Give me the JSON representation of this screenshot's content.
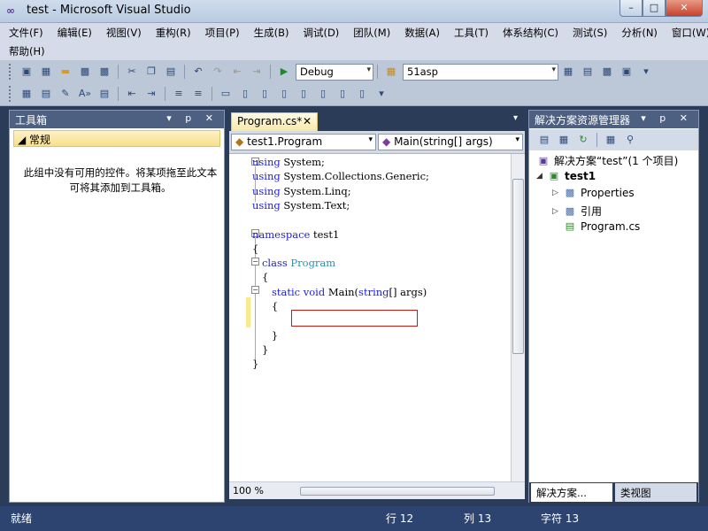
{
  "window": {
    "title": "test - Microsoft Visual Studio",
    "min": "–",
    "max": "□",
    "close": "✕"
  },
  "menu": {
    "row1": [
      "文件(F)",
      "编辑(E)",
      "视图(V)",
      "重构(R)",
      "项目(P)",
      "生成(B)",
      "调试(D)",
      "团队(M)",
      "数据(A)",
      "工具(T)",
      "体系结构(C)",
      "测试(S)",
      "分析(N)",
      "窗口(W)"
    ],
    "row2": [
      "帮助(H)"
    ]
  },
  "toolbar": {
    "config": "Debug",
    "find": "51asp",
    "combo_arrow": "▾"
  },
  "toolbox": {
    "title": "工具箱",
    "controls": "▾ p ✕",
    "group": "◢ 常规",
    "empty_message": "此组中没有可用的控件。将某项拖至此文本可将其添加到工具箱。"
  },
  "editor": {
    "tab_label": "Program.cs*",
    "tab_close": "✕",
    "class_combo": "test1.Program",
    "member_combo": "Main(string[] args)",
    "zoom": "100 %",
    "lines": [
      {
        "n": 0,
        "parts": [
          [
            "kw",
            "using"
          ],
          [
            "",
            " System;"
          ]
        ]
      },
      {
        "n": 1,
        "parts": [
          [
            "kw",
            "using"
          ],
          [
            "",
            " System.Collections.Generic;"
          ]
        ]
      },
      {
        "n": 2,
        "parts": [
          [
            "kw",
            "using"
          ],
          [
            "",
            " System.Linq;"
          ]
        ]
      },
      {
        "n": 3,
        "parts": [
          [
            "kw",
            "using"
          ],
          [
            "",
            " System.Text;"
          ]
        ]
      },
      {
        "n": 5,
        "parts": [
          [
            "kw",
            "namespace"
          ],
          [
            "",
            " test1"
          ]
        ]
      },
      {
        "n": 6,
        "parts": [
          [
            "",
            "{"
          ]
        ]
      },
      {
        "n": 7,
        "parts": [
          [
            "",
            "   "
          ],
          [
            "kw",
            "class"
          ],
          [
            "",
            " "
          ],
          [
            "typ",
            "Program"
          ]
        ]
      },
      {
        "n": 8,
        "parts": [
          [
            "",
            "   {"
          ]
        ]
      },
      {
        "n": 9,
        "parts": [
          [
            "",
            "      "
          ],
          [
            "kw",
            "static"
          ],
          [
            "",
            " "
          ],
          [
            "kw",
            "void"
          ],
          [
            "",
            " Main("
          ],
          [
            "kw",
            "string"
          ],
          [
            "",
            "[] args)"
          ]
        ]
      },
      {
        "n": 10,
        "parts": [
          [
            "",
            "      {"
          ]
        ]
      },
      {
        "n": 12,
        "parts": [
          [
            "",
            "      }"
          ]
        ]
      },
      {
        "n": 13,
        "parts": [
          [
            "",
            "   }"
          ]
        ]
      },
      {
        "n": 14,
        "parts": [
          [
            "",
            "}"
          ]
        ]
      }
    ]
  },
  "solution": {
    "title": "解决方案资源管理器",
    "controls": "▾ p ✕",
    "root": "解决方案“test”(1 个项目)",
    "project": "test1",
    "items": [
      "Properties",
      "引用",
      "Program.cs"
    ],
    "bottom_tabs": [
      "解决方案...",
      "类视图"
    ]
  },
  "status": {
    "ready": "就绪",
    "line": "行 12",
    "col": "列 13",
    "char": "字符 13"
  }
}
